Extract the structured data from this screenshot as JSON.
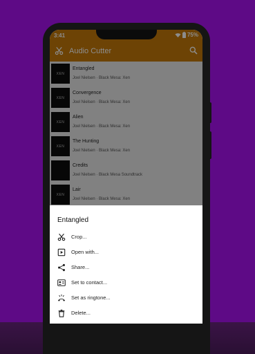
{
  "colors": {
    "background": "#5e0a86",
    "accent": "#c77b0a",
    "scrim": "rgba(0,0,0,0.45)",
    "sheet": "#ffffff"
  },
  "status_bar": {
    "time": "3:41",
    "battery": "75%",
    "icons": [
      "wifi-icon",
      "battery-icon"
    ]
  },
  "toolbar": {
    "title": "Audio Cutter",
    "logo_icon": "scissors-icon",
    "search_icon": "search-icon"
  },
  "tracks": [
    {
      "title": "Entangled",
      "subtitle": "Joel Nielsen · Black Mesa: Xen",
      "thumb": "XEN"
    },
    {
      "title": "Convergence",
      "subtitle": "Joel Nielsen · Black Mesa: Xen",
      "thumb": "XEN"
    },
    {
      "title": "Alien",
      "subtitle": "Joel Nielsen · Black Mesa: Xen",
      "thumb": "XEN"
    },
    {
      "title": "The Hunting",
      "subtitle": "Joel Nielsen · Black Mesa: Xen",
      "thumb": "XEN"
    },
    {
      "title": "Credits",
      "subtitle": "Joel Nielsen · Black Mesa Soundtrack",
      "thumb": ""
    },
    {
      "title": "Lair",
      "subtitle": "Joel Nielsen · Black Mesa: Xen",
      "thumb": "XEN"
    }
  ],
  "sheet": {
    "title": "Entangled",
    "items": [
      {
        "label": "Crop...",
        "icon": "scissors-icon"
      },
      {
        "label": "Open with...",
        "icon": "play-box-icon"
      },
      {
        "label": "Share...",
        "icon": "share-icon"
      },
      {
        "label": "Set to contact...",
        "icon": "contact-card-icon"
      },
      {
        "label": "Set as ringtone...",
        "icon": "ringtone-icon"
      },
      {
        "label": "Delete...",
        "icon": "trash-icon"
      }
    ]
  }
}
